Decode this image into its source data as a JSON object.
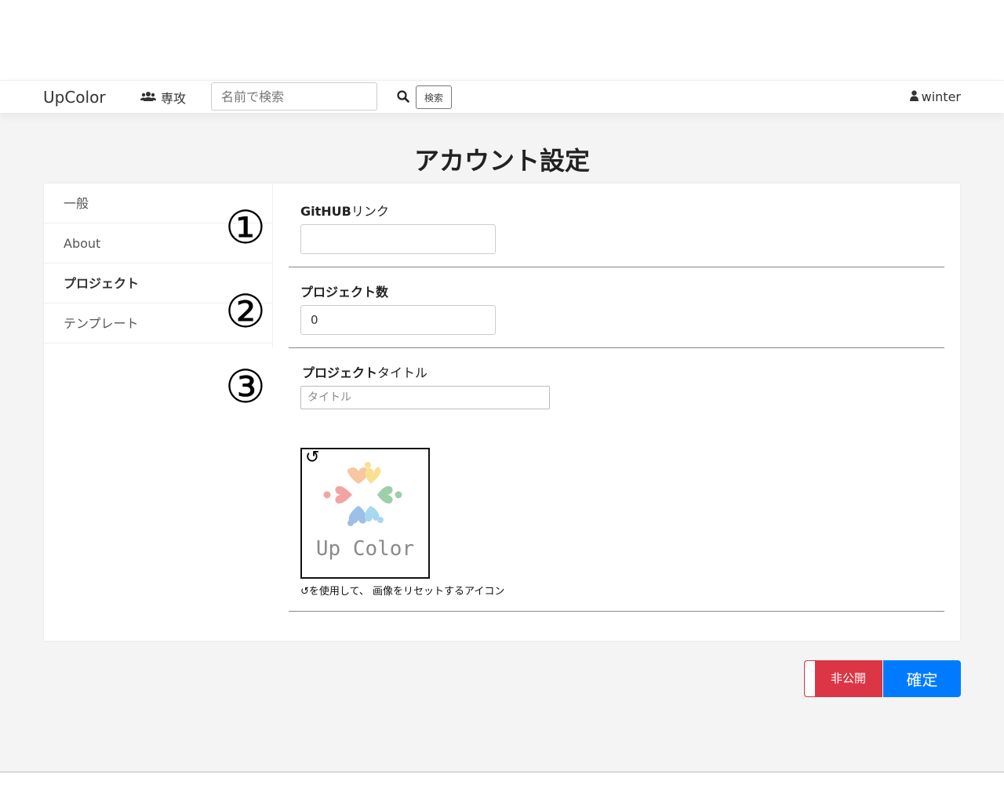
{
  "navbar": {
    "brand": "UpColor",
    "major_label": "専攻",
    "search_placeholder": "名前で検索",
    "search_button": "検索",
    "username": "winter"
  },
  "page_title": "アカウント設定",
  "side_menu": {
    "items": [
      {
        "label": "一般"
      },
      {
        "label": "About"
      },
      {
        "label": "プロジェクト"
      },
      {
        "label": "テンプレート"
      }
    ]
  },
  "annotations": [
    "①",
    "②",
    "③"
  ],
  "form": {
    "github_label_bold": "GitHUB",
    "github_label_rest": "リンク",
    "github_value": "",
    "project_count_label": "プロジェクト数",
    "project_count_value": "0",
    "project_title_label_bold": "プロジェクト",
    "project_title_label_rest": "タイトル",
    "project_title_placeholder": "タイトル",
    "reset_icon": "↺",
    "logo_text": "Up Color",
    "image_caption": "↺を使用して、 画像をリセットするアイコン"
  },
  "buttons": {
    "private": "非公開",
    "confirm": "確定"
  },
  "colors": {
    "danger": "#dc3545",
    "primary": "#007bff",
    "background": "#f4f4f4"
  }
}
